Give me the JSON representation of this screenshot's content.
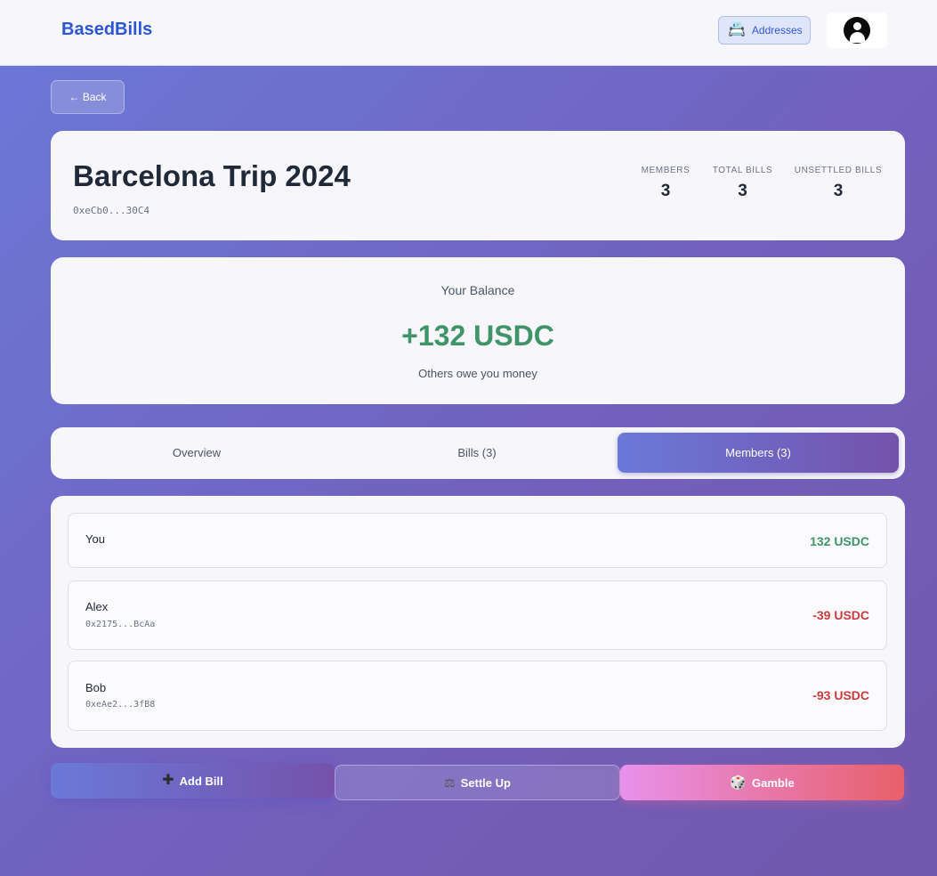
{
  "header": {
    "brand": "BasedBills",
    "addresses_label": "Addresses",
    "addresses_icon": "address-book-icon",
    "avatar_icon": "user-circle-icon"
  },
  "nav": {
    "back_label": "← Back"
  },
  "group": {
    "title": "Barcelona Trip 2024",
    "address": "0xeCb0...30C4",
    "stats": [
      {
        "label": "MEMBERS",
        "value": "3"
      },
      {
        "label": "TOTAL BILLS",
        "value": "3"
      },
      {
        "label": "UNSETTLED BILLS",
        "value": "3"
      }
    ]
  },
  "balance": {
    "label": "Your Balance",
    "amount": "+132 USDC",
    "note": "Others owe you money",
    "color": "#3f9468"
  },
  "tabs": [
    {
      "label": "Overview",
      "active": false
    },
    {
      "label": "Bills (3)",
      "active": false
    },
    {
      "label": "Members (3)",
      "active": true
    }
  ],
  "members": [
    {
      "name": "You",
      "address": "",
      "amount": "132 USDC",
      "status": "positive"
    },
    {
      "name": "Alex",
      "address": "0x2175...BcAa",
      "amount": "-39 USDC",
      "status": "negative"
    },
    {
      "name": "Bob",
      "address": "0xeAe2...3fB8",
      "amount": "-93 USDC",
      "status": "negative"
    }
  ],
  "actions": {
    "add_bill": {
      "label": "Add Bill",
      "icon": "plus-icon"
    },
    "settle_up": {
      "label": "Settle Up",
      "icon": "scale-icon"
    },
    "gamble": {
      "label": "Gamble",
      "icon": "dice-icon"
    }
  },
  "colors": {
    "accent": "#2d56d6",
    "positive": "#3f9468",
    "negative": "#c93b3b"
  }
}
